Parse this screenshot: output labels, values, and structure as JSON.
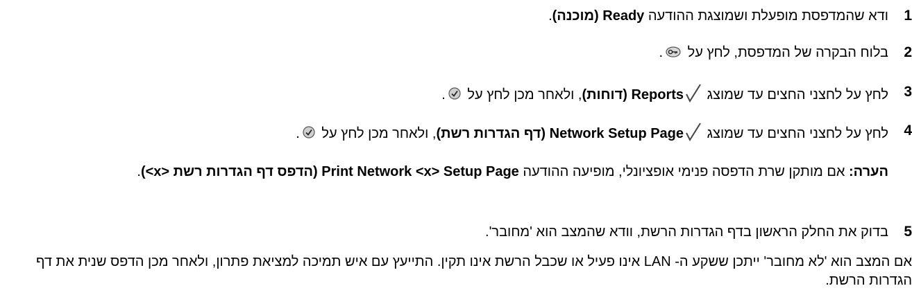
{
  "steps": [
    {
      "number": "1",
      "text_before": "ודא שהמדפסת מופעלת ושמוצגת ההודעה ",
      "bold": "Ready (מוכנה)",
      "text_after": "."
    },
    {
      "number": "2",
      "text_before": "בלוח הבקרה של המדפסת, לחץ על ",
      "icon": "menu-key-icon",
      "text_after": "."
    },
    {
      "number": "3",
      "text_before": "לחץ על לחצני החצים עד שמוצג ",
      "bold": "Reports (דוחות)",
      "text_after": ", ולאחר מכן לחץ על ",
      "icon": "select-button-icon",
      "end": "."
    },
    {
      "number": "4",
      "text_before": "לחץ על לחצני החצים עד שמוצג ",
      "bold": "Network Setup Page (דף הגדרות רשת)",
      "text_after": ", ולאחר מכן לחץ על ",
      "icon": "select-button-icon",
      "end": "."
    },
    {
      "number": "5",
      "text_before": "בדוק את החלק הראשון בדף הגדרות הרשת, וודא שהמצב הוא 'מחובר'."
    }
  ],
  "note": {
    "label": "הערה:",
    "text_before": " אם מותקן שרת הדפסה פנימי אופציונלי, מופיעה ההודעה ",
    "bold": "Print Network <x> Setup Page (הדפס דף הגדרות רשת <x>)",
    "text_after": "."
  },
  "final_paragraph": "אם המצב הוא 'לא מחובר' ייתכן ששקע ה- LAN אינו פעיל או שכבל הרשת אינו תקין. התייעץ עם איש תמיכה למציאת פתרון, ולאחר מכן הדפס שנית את דף הגדרות הרשת.",
  "colors": {
    "text": "#000000",
    "background": "#ffffff"
  }
}
